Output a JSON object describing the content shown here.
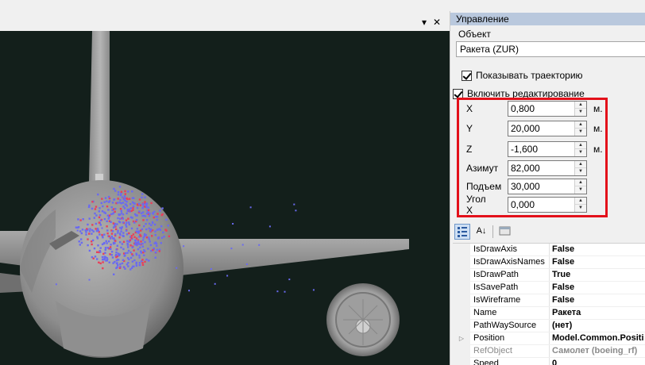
{
  "viewport": {
    "dropdown_glyph": "▾",
    "close_glyph": "✕"
  },
  "panel": {
    "title": "Управление",
    "object_label": "Объект",
    "object_value": "Ракета (ZUR)",
    "show_path_label": "Показывать траекторию",
    "show_path_checked": true,
    "edit_label": "Включить редактирование",
    "edit_checked": true,
    "params": [
      {
        "label": "X",
        "value": "0,800",
        "unit": "м."
      },
      {
        "label": "Y",
        "value": "20,000",
        "unit": "м."
      },
      {
        "label": "Z",
        "value": "-1,600",
        "unit": "м."
      },
      {
        "label": "Азимут",
        "value": "82,000",
        "unit": ""
      },
      {
        "label": "Подъем",
        "value": "30,000",
        "unit": ""
      },
      {
        "label": "Угол X",
        "value": "0,000",
        "unit": ""
      }
    ]
  },
  "property_grid": {
    "toolbar": {
      "categorized_icon": "categorized-icon",
      "alphabetical_icon": "alphabetical-sort-icon",
      "alphabetical_glyph": "A↓",
      "property_pages_icon": "property-pages-icon"
    },
    "rows": [
      {
        "name": "IsDrawAxis",
        "value": "False",
        "expandable": false,
        "readonly": false
      },
      {
        "name": "IsDrawAxisNames",
        "value": "False",
        "expandable": false,
        "readonly": false
      },
      {
        "name": "IsDrawPath",
        "value": "True",
        "expandable": false,
        "readonly": false
      },
      {
        "name": "IsSavePath",
        "value": "False",
        "expandable": false,
        "readonly": false
      },
      {
        "name": "IsWireframe",
        "value": "False",
        "expandable": false,
        "readonly": false
      },
      {
        "name": "Name",
        "value": "Ракета",
        "expandable": false,
        "readonly": false
      },
      {
        "name": "PathWaySource",
        "value": "(нет)",
        "expandable": false,
        "readonly": false
      },
      {
        "name": "Position",
        "value": "Model.Common.Positi",
        "expandable": true,
        "readonly": false
      },
      {
        "name": "RefObject",
        "value": "Самолет (boeing_rf)",
        "expandable": false,
        "readonly": true
      },
      {
        "name": "Speed",
        "value": "0",
        "expandable": false,
        "readonly": false
      }
    ]
  },
  "colors": {
    "viewport_bg": "#131f1b",
    "model_gray": "#9a9a9a",
    "highlight_box": "#e3101a",
    "panel_header": "#b9c8dd",
    "particle_blue": "#6a6af0",
    "particle_red": "#e8405a"
  }
}
